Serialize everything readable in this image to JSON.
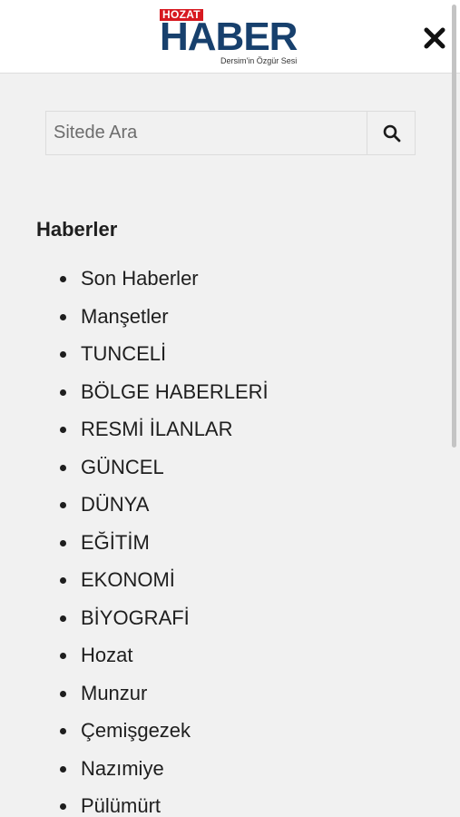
{
  "header": {
    "logo": {
      "badge": "HOZAT",
      "main": "HABER",
      "tagline": "Dersim'in Özgür Sesi"
    },
    "close_icon": "close-icon"
  },
  "search": {
    "placeholder": "Sitede Ara",
    "value": "",
    "button_icon": "search-icon"
  },
  "menu": {
    "title": "Haberler",
    "items": [
      {
        "label": "Son Haberler"
      },
      {
        "label": "Manşetler"
      },
      {
        "label": "TUNCELİ"
      },
      {
        "label": "BÖLGE HABERLERİ"
      },
      {
        "label": "RESMİ İLANLAR"
      },
      {
        "label": "GÜNCEL"
      },
      {
        "label": "DÜNYA"
      },
      {
        "label": "EĞİTİM"
      },
      {
        "label": "EKONOMİ"
      },
      {
        "label": "BİYOGRAFİ"
      },
      {
        "label": "Hozat"
      },
      {
        "label": "Munzur"
      },
      {
        "label": "Çemişgezek"
      },
      {
        "label": "Nazımiye"
      },
      {
        "label": "Pülümürt"
      }
    ]
  },
  "colors": {
    "brand_red": "#d71920",
    "brand_blue": "#17406d",
    "panel_bg": "#f1f1f1",
    "text": "#1e1e1e"
  }
}
